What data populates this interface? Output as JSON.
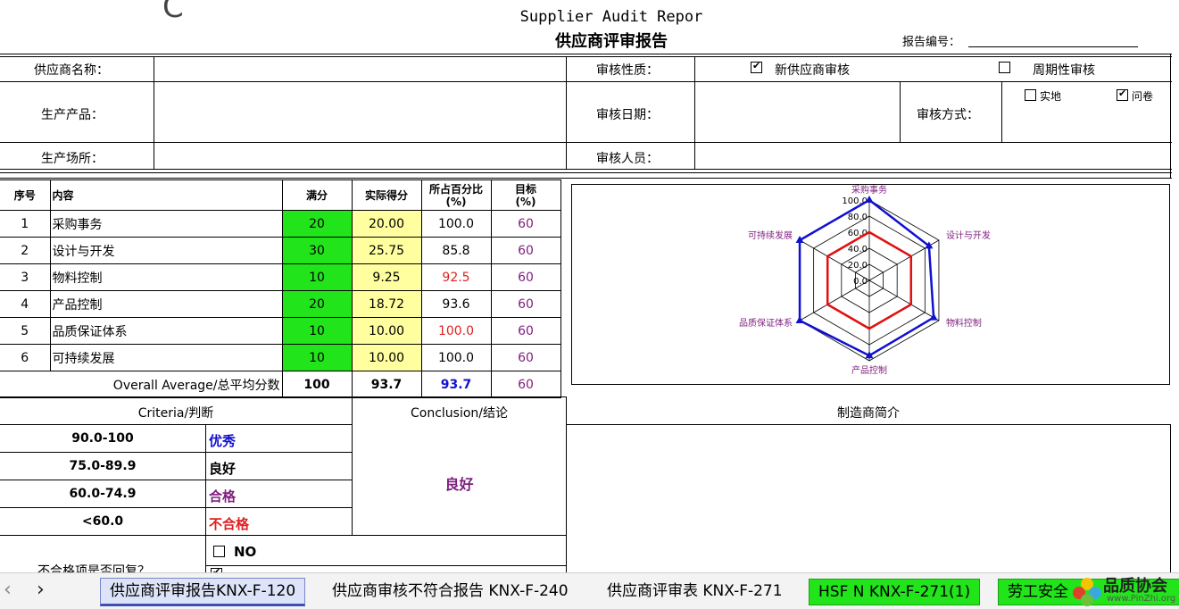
{
  "header": {
    "title_en": "Supplier Audit Repor",
    "title_cn": "供应商评审报告",
    "report_no_label": "报告编号：",
    "partial_char": "C"
  },
  "info": {
    "supplier_name_label": "供应商名称：",
    "product_label": "生产产品：",
    "site_label": "生产场所：",
    "audit_type_label": "审核性质：",
    "new_supplier_label": "新供应商审核",
    "periodic_label": "周期性审核",
    "audit_date_label": "审核日期：",
    "audit_method_label": "审核方式：",
    "onsite_label": "实地",
    "questionnaire_label": "问卷",
    "auditor_label": "审核人员："
  },
  "table": {
    "headers": {
      "no": "序号",
      "content": "内容",
      "full": "满分",
      "actual": "实际得分",
      "percent": "所占百分比",
      "percent_unit": "(%)",
      "target": "目标",
      "target_unit": "(%)"
    },
    "rows": [
      {
        "no": "1",
        "content": "采购事务",
        "full": "20",
        "actual": "20.00",
        "percent": "100.0",
        "target": "60"
      },
      {
        "no": "2",
        "content": "设计与开发",
        "full": "30",
        "actual": "25.75",
        "percent": "85.8",
        "target": "60"
      },
      {
        "no": "3",
        "content": "物料控制",
        "full": "10",
        "actual": "9.25",
        "percent": "92.5",
        "target": "60"
      },
      {
        "no": "4",
        "content": "产品控制",
        "full": "20",
        "actual": "18.72",
        "percent": "93.6",
        "target": "60"
      },
      {
        "no": "5",
        "content": "品质保证体系",
        "full": "10",
        "actual": "10.00",
        "percent": "100.0",
        "target": "60"
      },
      {
        "no": "6",
        "content": "可持续发展",
        "full": "10",
        "actual": "10.00",
        "percent": "100.0",
        "target": "60"
      }
    ],
    "average": {
      "label": "Overall Average/总平均分数",
      "full": "100",
      "actual": "93.7",
      "percent": "93.7",
      "target": "60"
    }
  },
  "chart_data": {
    "type": "radar",
    "categories": [
      "采购事务",
      "设计与开发",
      "物料控制",
      "产品控制",
      "品质保证体系",
      "可持续发展"
    ],
    "series": [
      {
        "values": [
          100.0,
          85.8,
          92.5,
          93.6,
          100.0,
          100.0
        ],
        "color": "#1010d0"
      },
      {
        "values": [
          60,
          60,
          60,
          60,
          60,
          60
        ],
        "color": "#e01010"
      }
    ],
    "ticks": [
      "0.0",
      "20.0",
      "40.0",
      "60.0",
      "80.0",
      "100.0"
    ],
    "range": [
      0,
      100
    ]
  },
  "criteria": {
    "title": "Criteria/判断",
    "rows": [
      {
        "range": "90.0-100",
        "grade": "优秀",
        "color": "#1010d0"
      },
      {
        "range": "75.0-89.9",
        "grade": "良好",
        "color": "#000000"
      },
      {
        "range": "60.0-74.9",
        "grade": "合格",
        "color": "#7e1e7e"
      },
      {
        "range": "<60.0",
        "grade": "不合格",
        "color": "#e02020"
      }
    ]
  },
  "conclusion": {
    "title": "Conclusion/结论",
    "value": "良好"
  },
  "manufacturer": {
    "title": "制造商简介"
  },
  "reply": {
    "question": "不合格项是否回复？",
    "no_label": "NO"
  },
  "tabs": [
    {
      "label": "供应商评审报告KNX-F-120",
      "active": true
    },
    {
      "label": "供应商审核不符合报告 KNX-F-240",
      "active": false
    },
    {
      "label": "供应商评审表 KNX-F-271",
      "active": false
    },
    {
      "label": "HSF N KNX-F-271(1)",
      "active": false,
      "color": "#22e41b"
    },
    {
      "label": "劳工安全",
      "active": false,
      "color": "#22e41b"
    }
  ],
  "nav": {
    "prev": "‹",
    "next": "›"
  },
  "watermark": {
    "text": "品质协会",
    "url": "www.PinZhi.org"
  }
}
